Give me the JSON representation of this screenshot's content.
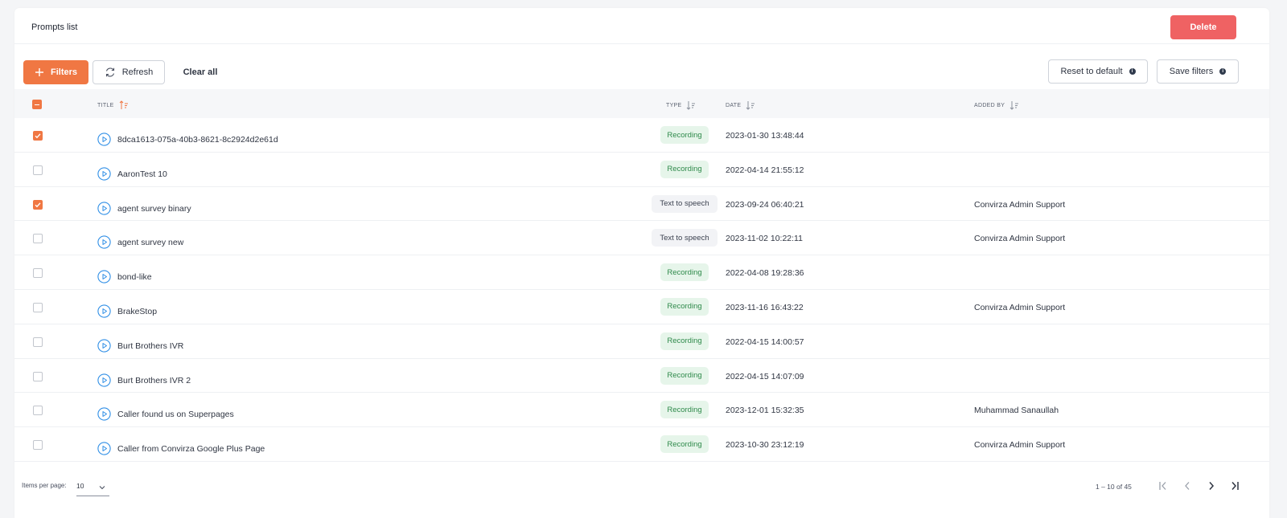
{
  "header": {
    "title": "Prompts list",
    "delete_label": "Delete"
  },
  "toolbar": {
    "filters_label": "Filters",
    "refresh_label": "Refresh",
    "clear_label": "Clear all",
    "reset_label": "Reset to default",
    "save_label": "Save filters"
  },
  "table": {
    "columns": {
      "title": "TITLE",
      "type": "TYPE",
      "date": "DATE",
      "added_by": "ADDED BY"
    },
    "rows": [
      {
        "checked": true,
        "title": "8dca1613-075a-40b3-8621-8c2924d2e61d",
        "type": "Recording",
        "date": "2023-01-30 13:48:44",
        "added_by": ""
      },
      {
        "checked": false,
        "title": "AaronTest 10",
        "type": "Recording",
        "date": "2022-04-14 21:55:12",
        "added_by": ""
      },
      {
        "checked": true,
        "title": "agent survey binary",
        "type": "Text to speech",
        "date": "2023-09-24 06:40:21",
        "added_by": "Convirza Admin Support"
      },
      {
        "checked": false,
        "title": "agent survey new",
        "type": "Text to speech",
        "date": "2023-11-02 10:22:11",
        "added_by": "Convirza Admin Support"
      },
      {
        "checked": false,
        "title": "bond-like",
        "type": "Recording",
        "date": "2022-04-08 19:28:36",
        "added_by": ""
      },
      {
        "checked": false,
        "title": "BrakeStop",
        "type": "Recording",
        "date": "2023-11-16 16:43:22",
        "added_by": "Convirza Admin Support"
      },
      {
        "checked": false,
        "title": "Burt Brothers IVR",
        "type": "Recording",
        "date": "2022-04-15 14:00:57",
        "added_by": ""
      },
      {
        "checked": false,
        "title": "Burt Brothers IVR 2",
        "type": "Recording",
        "date": "2022-04-15 14:07:09",
        "added_by": ""
      },
      {
        "checked": false,
        "title": "Caller found us on Superpages",
        "type": "Recording",
        "date": "2023-12-01 15:32:35",
        "added_by": "Muhammad Sanaullah"
      },
      {
        "checked": false,
        "title": "Caller from Convirza Google Plus Page",
        "type": "Recording",
        "date": "2023-10-30 23:12:19",
        "added_by": "Convirza Admin Support"
      }
    ]
  },
  "footer": {
    "items_per_page_label": "Items per page:",
    "items_per_page_value": "10",
    "range_label": "1 – 10 of 45"
  },
  "colors": {
    "accent": "#f07743",
    "danger": "#ef6263",
    "play": "#2e8ee6",
    "recording_bg": "#e6f5ea",
    "recording_text": "#2f8a4b"
  },
  "icons": {
    "filters": "plus-icon",
    "refresh": "refresh-icon",
    "info": "info-icon",
    "sort": "sort-icon",
    "play": "play-icon",
    "chevron": "chevron-down-icon",
    "first": "first-page-icon",
    "prev": "previous-page-icon",
    "next": "next-page-icon",
    "last": "last-page-icon"
  }
}
